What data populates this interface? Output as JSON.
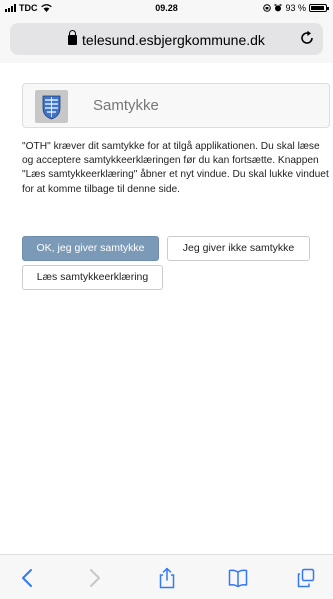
{
  "status_bar": {
    "carrier": "TDC",
    "time": "09.28",
    "battery_percent": "93 %"
  },
  "browser": {
    "url": "telesund.esbjergkommune.dk"
  },
  "consent": {
    "title": "Samtykke",
    "description": "\"OTH\" kræver dit samtykke for at tilgå applikationen. Du skal læse og acceptere samtykkeerklæringen før du kan fortsætte. Knappen \"Læs samtykkeerklæring\" åbner et nyt vindue. Du skal lukke vinduet for at komme tilbage til denne side.",
    "accept_label": "OK, jeg giver samtykke",
    "decline_label": "Jeg giver ikke samtykke",
    "read_label": "Læs samtykkeerklæring"
  },
  "toolbar": {
    "icons": [
      "back-icon",
      "forward-icon",
      "share-icon",
      "bookmarks-icon",
      "tabs-icon"
    ]
  },
  "colors": {
    "primary_button": "#7b9ab8",
    "ios_blue": "#3478f6",
    "chrome_bg": "#f7f7f7"
  }
}
